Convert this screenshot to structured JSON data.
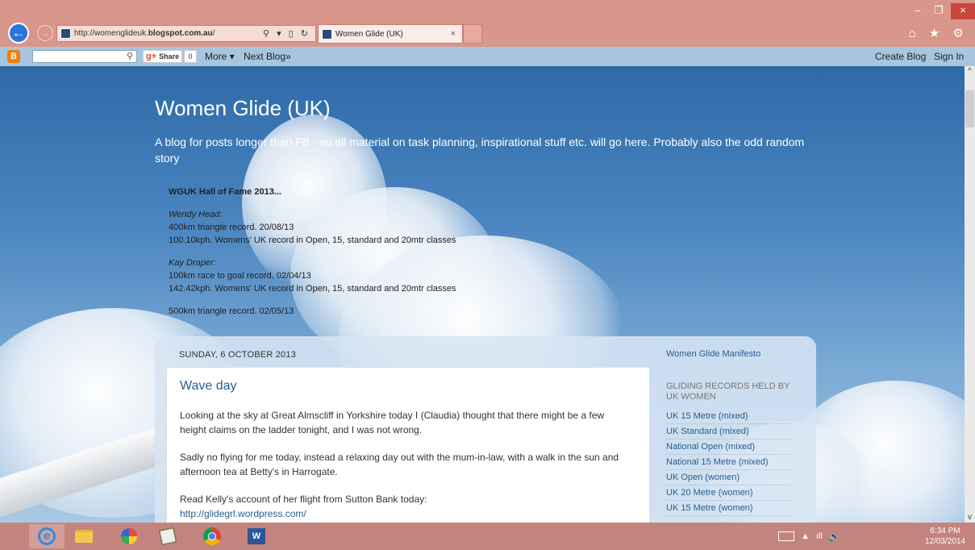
{
  "browser": {
    "url_prefix": "http://womenglideuk.",
    "url_domain": "blogspot.com.au",
    "url_suffix": "/",
    "address_icons": "⚲ ▾ ▯ ↻",
    "tab_title": "Women Glide (UK)",
    "tab_close": "×",
    "window_minimize": "–",
    "window_restore": "❐",
    "window_close": "×",
    "right_icons": "⌂ ★ ⚙"
  },
  "blogger_bar": {
    "logo": "B",
    "search_icon": "⚲",
    "share_label": "Share",
    "share_g": "g+",
    "share_count": "0",
    "more": "More ▾",
    "next_blog": "Next Blog»",
    "create_blog": "Create Blog",
    "sign_in": "Sign In"
  },
  "blog": {
    "title": "Women Glide (UK)",
    "description": "A blog for posts longer than FB - so all material on task planning, inspirational stuff etc. will go here. Probably also the odd random story"
  },
  "hall_of_fame": {
    "heading": "WGUK Hall of Fame 2013...",
    "entries": [
      {
        "name": "Wendy Head:",
        "line1": "400km triangle record. 20/08/13",
        "line2": "100.10kph. Womens' UK record in Open, 15, standard and 20mtr classes"
      },
      {
        "name": "Kay Draper:",
        "line1": "100km race to goal record. 02/04/13",
        "line2": "142.42kph. Womens' UK record in Open, 15, standard and 20mtr classes"
      }
    ],
    "trailing_line": "500km triangle record. 02/05/13"
  },
  "post": {
    "date": "SUNDAY, 6 OCTOBER 2013",
    "title": "Wave day",
    "paragraphs": [
      "Looking at the sky at Great Almscliff in Yorkshire today I (Claudia) thought that there might be a few height claims on the ladder tonight, and I was not wrong.",
      "Sadly no flying for me today, instead a relaxing day out with the mum-in-law, with a walk in the sun and afternoon tea at Betty's in Harrogate.",
      "Read Kelly's account of her flight from Sutton Bank today:"
    ],
    "link": "http://glidegrl.wordpress.com/"
  },
  "sidebar": {
    "manifesto_link": "Women Glide Manifesto",
    "records_heading": "GLIDING RECORDS HELD BY UK WOMEN",
    "records": [
      "UK 15 Metre (mixed)",
      "UK Standard (mixed)",
      "National Open (mixed)",
      "National 15 Metre (mixed)",
      "UK Open (women)",
      "UK 20 Metre (women)",
      "UK 15 Metre (women)"
    ]
  },
  "taskbar": {
    "word_label": "W",
    "tray_up": "▲",
    "tray_network": "ıll",
    "tray_volume": "🔈",
    "time": "6:34 PM",
    "date": "12/03/2014"
  },
  "colors": {
    "chrome_bg": "#d9968a",
    "blogger_bar_bg": "#a8c5df",
    "link": "#2a5d8f",
    "taskbar_bg": "#c3847d"
  }
}
